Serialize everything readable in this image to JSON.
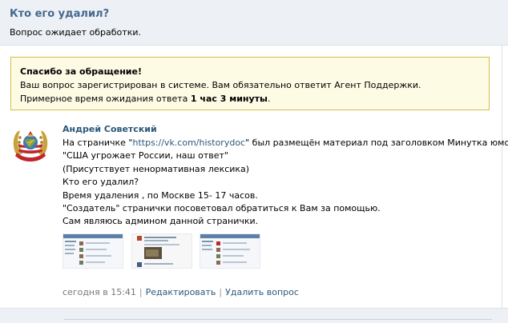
{
  "question": {
    "title": "Кто его удалил?",
    "status": "Вопрос ожидает обработки."
  },
  "notice": {
    "title": "Спасибо за обращение!",
    "line1": "Ваш вопрос зарегистрирован в системе. Вам обязательно ответит Агент Поддержки.",
    "line2_prefix": "Примерное время ожидания ответа ",
    "line2_bold": "1 час 3 минуты",
    "line2_suffix": "."
  },
  "post": {
    "author": "Андрей Советский",
    "line1_prefix": "На страничке \"",
    "line1_link": "https://vk.com/historydoc",
    "line1_suffix": "\" был размещён материал под заголовком Минутка юмора.",
    "line2": "\"США угрожает России, наш ответ\"",
    "line3": "(Присутствует ненормативная лексика)",
    "line4": "Кто его удалил?",
    "line5": "Время удаления , по Москве 15- 17 часов.",
    "line6": "\"Создатель\" странички посоветовал обратиться к Вам за помощью.",
    "line7": "Сам являюсь админом данной странички."
  },
  "meta": {
    "time": "сегодня в 15:41",
    "edit": "Редактировать",
    "delete": "Удалить вопрос"
  },
  "icons": {
    "avatar": "ussr-emblem-icon"
  },
  "colors": {
    "link": "#2b587a",
    "title": "#45688e",
    "notice_bg": "#fefbe5",
    "notice_border": "#d4bc4c",
    "header_bg": "#edf1f5"
  }
}
